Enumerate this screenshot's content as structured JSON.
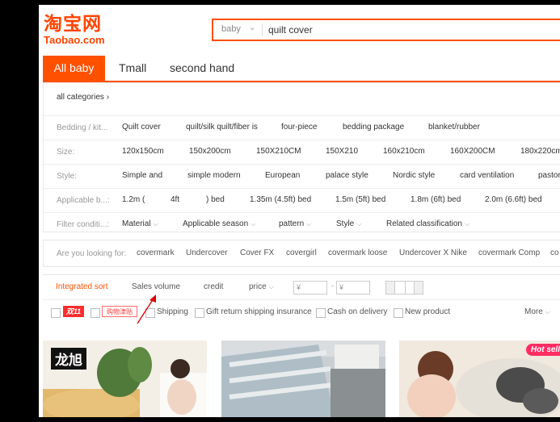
{
  "logo": {
    "cn": "淘宝网",
    "en": "Taobao.com"
  },
  "search": {
    "scope": "baby",
    "query": "quilt cover"
  },
  "tabs": [
    "All baby",
    "Tmall",
    "second hand"
  ],
  "breadcrumb": "all categories",
  "filters": [
    {
      "label": "Bedding / kit...",
      "values": [
        "Quilt cover",
        "quilt/silk quilt/fiber is",
        "four-piece",
        "bedding package",
        "blanket/rubber"
      ]
    },
    {
      "label": "Size:",
      "values": [
        "120x150cm",
        "150x200cm",
        "150X210CM",
        "150X210",
        "160x210cm",
        "160X200CM",
        "180x220cm"
      ]
    },
    {
      "label": "Style:",
      "values": [
        "Simple and",
        "simple modern",
        "European",
        "palace style",
        "Nordic style",
        "card ventilation",
        "pastor"
      ]
    },
    {
      "label": "Applicable b...:",
      "values": [
        "1.2m (",
        "4ft",
        ") bed",
        "1.35m (4.5ft) bed",
        "1.5m (5ft) bed",
        "1.8m (6ft) bed",
        "2.0m (6.6ft) bed"
      ]
    },
    {
      "label": "Filter conditi...:",
      "values": [
        "Material",
        "Applicable season",
        "pattern",
        "Style",
        "Related classification"
      ]
    }
  ],
  "suggest": {
    "label": "Are you looking for:",
    "items": [
      "covermark",
      "Undercover",
      "Cover FX",
      "covergirl",
      "covermark loose",
      "Undercover X Nike",
      "covermark Comp",
      "co"
    ]
  },
  "sort": {
    "items": [
      "Integrated sort",
      "Sales volume",
      "credit",
      "price"
    ],
    "price_from": "¥",
    "price_to": "¥",
    "dash": "-"
  },
  "checks": {
    "tag11": "双11",
    "tag_pink": "购物津贴",
    "items": [
      "Shipping",
      "Gift return shipping insurance",
      "Cash on delivery",
      "New product"
    ],
    "more": "More"
  },
  "products": {
    "brand": "龙旭",
    "hot": "Hot sell"
  },
  "colors": {
    "accent": "#ff5000",
    "tag_red": "#ff2d2d",
    "hot_pink": "#ff2d64"
  }
}
